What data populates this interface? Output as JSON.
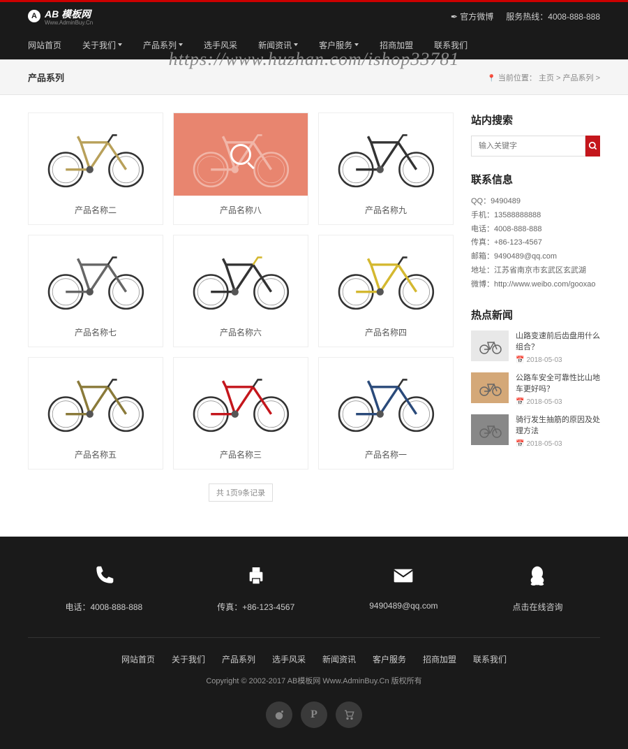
{
  "watermark": "https://www.huzhan.com/ishop33781",
  "topbar": {
    "logo_text": "AB 模板网",
    "logo_sub": "Www.AdminBuy.Cn",
    "weibo": "官方微博",
    "hotline_label": "服务热线：",
    "hotline": "4008-888-888"
  },
  "nav": [
    {
      "label": "网站首页",
      "dd": false
    },
    {
      "label": "关于我们",
      "dd": true
    },
    {
      "label": "产品系列",
      "dd": true
    },
    {
      "label": "选手风采",
      "dd": false
    },
    {
      "label": "新闻资讯",
      "dd": true
    },
    {
      "label": "客户服务",
      "dd": true
    },
    {
      "label": "招商加盟",
      "dd": false
    },
    {
      "label": "联系我们",
      "dd": false
    }
  ],
  "breadcrumb": {
    "title": "产品系列",
    "position_label": "当前位置：",
    "home": "主页",
    "sep": " > ",
    "current": "产品系列",
    "tail": " >"
  },
  "products": [
    {
      "name": "产品名称二"
    },
    {
      "name": "产品名称八"
    },
    {
      "name": "产品名称九"
    },
    {
      "name": "产品名称七"
    },
    {
      "name": "产品名称六"
    },
    {
      "name": "产品名称四"
    },
    {
      "name": "产品名称五"
    },
    {
      "name": "产品名称三"
    },
    {
      "name": "产品名称一"
    }
  ],
  "pagination": {
    "info": "共 1页9条记录"
  },
  "sidebar": {
    "search_title": "站内搜索",
    "search_placeholder": "输入关键字",
    "contact_title": "联系信息",
    "contact": [
      "QQ：9490489",
      "手机：13588888888",
      "电话：4008-888-888",
      "传真：+86-123-4567",
      "邮箱：9490489@qq.com",
      "地址：江苏省南京市玄武区玄武湖",
      "微博：http://www.weibo.com/gooxao"
    ],
    "news_title": "热点新闻",
    "news": [
      {
        "title": "山路变速前后齿盘用什么组合？",
        "date": "2018-05-03"
      },
      {
        "title": "公路车安全可靠性比山地车更好吗？",
        "date": "2018-05-03"
      },
      {
        "title": "骑行发生抽筋的原因及处理方法",
        "date": "2018-05-03"
      }
    ]
  },
  "footer": {
    "contacts": [
      {
        "icon": "phone",
        "text": "电话：4008-888-888"
      },
      {
        "icon": "fax",
        "text": "传真：+86-123-4567"
      },
      {
        "icon": "mail",
        "text": "9490489@qq.com"
      },
      {
        "icon": "qq",
        "text": "点击在线咨询"
      }
    ],
    "nav": [
      "网站首页",
      "关于我们",
      "产品系列",
      "选手风采",
      "新闻资讯",
      "客户服务",
      "招商加盟",
      "联系我们"
    ],
    "copyright": "Copyright © 2002-2017 AB模板网 Www.AdminBuy.Cn 版权所有"
  }
}
